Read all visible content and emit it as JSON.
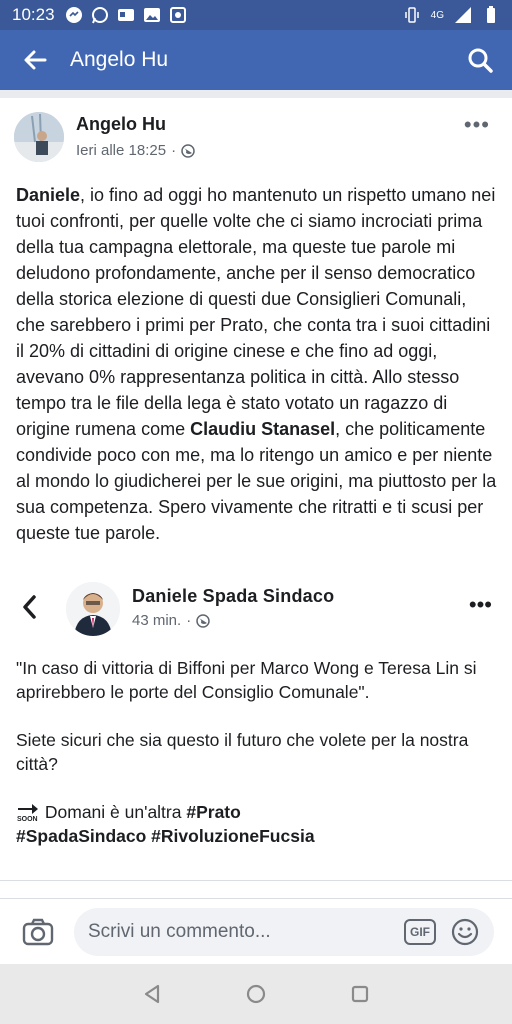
{
  "statusbar": {
    "time": "10:23",
    "network": "4G"
  },
  "appbar": {
    "title": "Angelo Hu"
  },
  "post": {
    "author": "Angelo Hu",
    "time": "Ieri alle 18:25",
    "text_lead": "Daniele",
    "text_part1": ", io fino ad oggi ho mantenuto un rispetto umano nei tuoi confronti, per quelle volte che ci siamo incrociati prima della tua campagna elettorale, ma queste tue parole mi deludono profondamente, anche per il senso democratico della storica elezione di questi due Consiglieri Comunali, che sarebbero i primi per Prato, che conta tra i suoi cittadini il 20% di cittadini di origine cinese e che fino ad oggi, avevano 0% rappresentanza politica in città. Allo stesso tempo tra le file della lega è stato votato un ragazzo di origine rumena come ",
    "text_name": "Claudiu Stanasel",
    "text_part2": ", che politicamente condivide poco con me, ma lo ritengo un amico e per niente al mondo lo giudicherei per le sue origini, ma piuttosto per la sua competenza. Spero vivamente che ritratti e ti scusi per queste tue parole."
  },
  "shared": {
    "author": "Daniele Spada Sindaco",
    "time": "43 min.",
    "paragraph1": "\"In caso di vittoria di Biffoni per Marco Wong e Teresa Lin si aprirebbero le porte del Consiglio Comunale\".",
    "paragraph2": "Siete sicuri che sia questo il futuro che volete per la nostra città?",
    "line3_text": "Domani è un'altra ",
    "line3_tag": "#Prato",
    "line4_tags": "#SpadaSindaco #RivoluzioneFucsia"
  },
  "comment": {
    "placeholder": "Scrivi un commento...",
    "gif_label": "GIF"
  },
  "colors": {
    "header": "#4267b2",
    "statusbar": "#3b5998"
  }
}
